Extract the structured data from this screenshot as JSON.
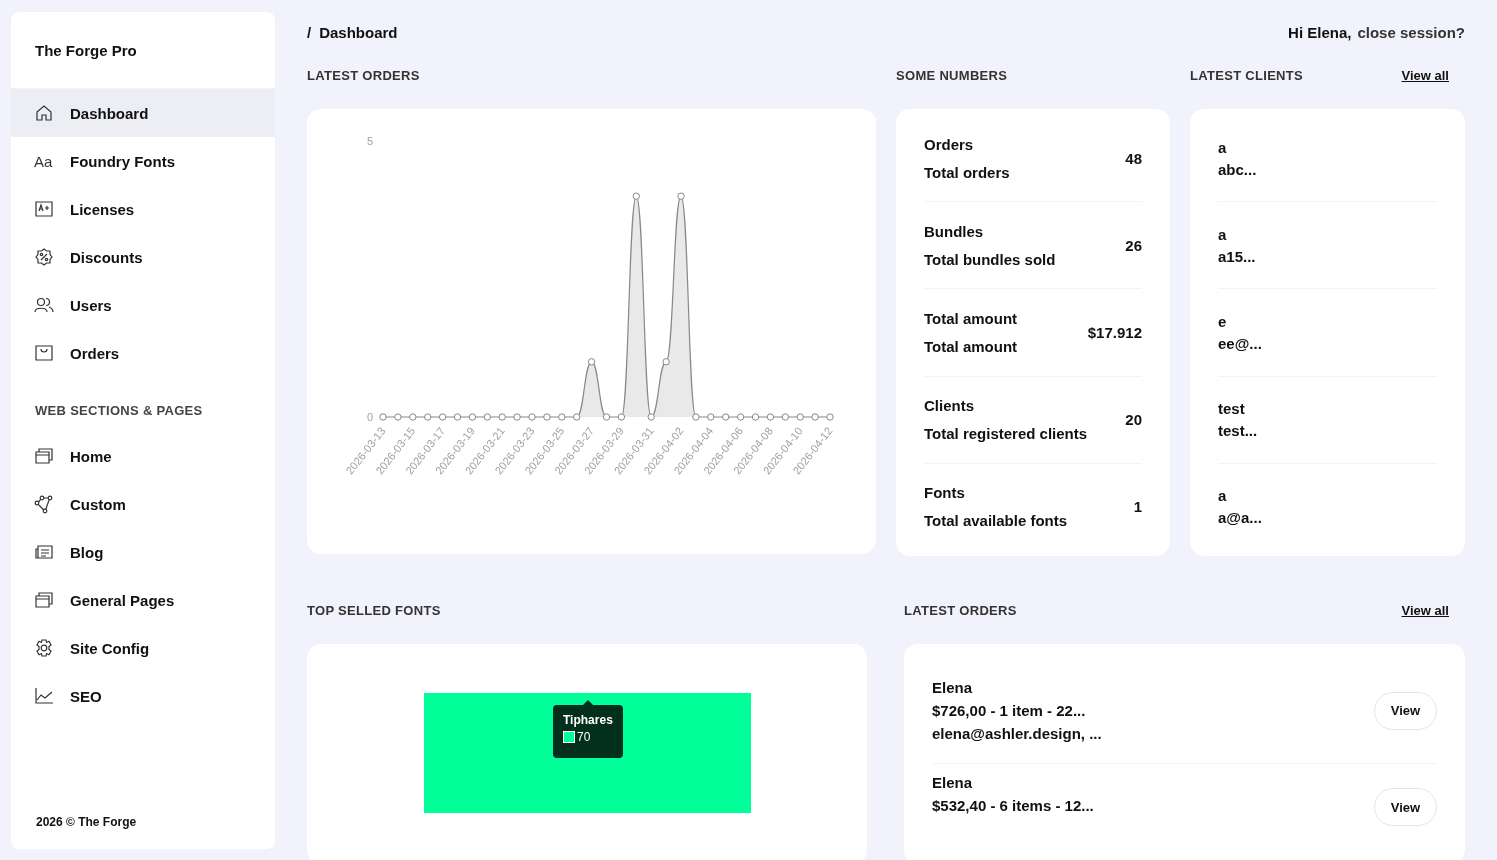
{
  "brand": "The Forge Pro",
  "sidebar": {
    "items": [
      {
        "label": "Dashboard",
        "selected": true
      },
      {
        "label": "Foundry Fonts",
        "glyph": "Aa",
        "selected": false
      },
      {
        "label": "Licenses",
        "selected": false
      },
      {
        "label": "Discounts",
        "selected": false
      },
      {
        "label": "Users",
        "selected": false
      },
      {
        "label": "Orders",
        "selected": false
      }
    ],
    "section_title": "WEB SECTIONS & PAGES",
    "section_items": [
      {
        "label": "Home",
        "selected": false
      },
      {
        "label": "Custom",
        "selected": false
      },
      {
        "label": "Blog",
        "selected": false
      },
      {
        "label": "General Pages",
        "selected": false
      },
      {
        "label": "Site Config",
        "selected": false
      },
      {
        "label": "SEO",
        "selected": false
      }
    ],
    "footer": "2026 © The Forge"
  },
  "breadcrumb": {
    "separator": "/",
    "current": "Dashboard"
  },
  "greeting": "Hi Elena,",
  "logout": "close session?",
  "latest_orders_chart": {
    "heading": "LATEST ORDERS",
    "chart_data": {
      "type": "area",
      "x": [
        "2026-03-13",
        "2026-03-14",
        "2026-03-15",
        "2026-03-16",
        "2026-03-17",
        "2026-03-18",
        "2026-03-19",
        "2026-03-20",
        "2026-03-21",
        "2026-03-22",
        "2026-03-23",
        "2026-03-24",
        "2026-03-25",
        "2026-03-26",
        "2026-03-27",
        "2026-03-28",
        "2026-03-29",
        "2026-03-30",
        "2026-03-31",
        "2026-04-01",
        "2026-04-02",
        "2026-04-03",
        "2026-04-04",
        "2026-04-05",
        "2026-04-06",
        "2026-04-07",
        "2026-04-08",
        "2026-04-09",
        "2026-04-10",
        "2026-04-11",
        "2026-04-12"
      ],
      "series": [
        {
          "color": "#888888",
          "values": [
            0,
            0,
            0,
            0,
            0,
            0,
            0,
            0,
            0,
            0,
            0,
            0,
            0,
            0,
            1,
            0,
            0,
            4,
            0,
            1,
            4,
            0,
            0,
            0,
            0,
            0,
            0,
            0,
            0,
            0,
            0
          ]
        }
      ],
      "xticks": [
        "2026-03-13",
        "2026-03-15",
        "2026-03-17",
        "2026-03-19",
        "2026-03-21",
        "2026-03-23",
        "2026-03-25",
        "2026-03-27",
        "2026-03-29",
        "2026-03-31",
        "2026-04-02",
        "2026-04-04",
        "2026-04-06",
        "2026-04-08",
        "2026-04-10",
        "2026-04-12"
      ],
      "xlim": [
        "2026-03-13",
        "2026-04-12"
      ],
      "ylim": [
        0,
        5
      ],
      "yticks": [
        0,
        5
      ]
    }
  },
  "some_numbers": {
    "heading": "SOME NUMBERS",
    "rows": [
      {
        "title": "Orders",
        "subtitle": "Total orders",
        "value": "48"
      },
      {
        "title": "Bundles",
        "subtitle": "Total bundles sold",
        "value": "26"
      },
      {
        "title": "Total amount",
        "subtitle": "Total amount",
        "value": "$17.912"
      },
      {
        "title": "Clients",
        "subtitle": "Total registered clients",
        "value": "20"
      },
      {
        "title": "Fonts",
        "subtitle": "Total available fonts",
        "value": "1"
      }
    ]
  },
  "latest_clients": {
    "heading": "LATEST CLIENTS",
    "link": "View all",
    "rows": [
      {
        "name": "a",
        "email": "abc..."
      },
      {
        "name": "a",
        "email": "a15..."
      },
      {
        "name": "e",
        "email": "ee@..."
      },
      {
        "name": "test",
        "email": "test..."
      },
      {
        "name": "a",
        "email": "a@a..."
      }
    ]
  },
  "top_selled_fonts": {
    "heading": "TOP SELLED FONTS",
    "tooltip": {
      "title": "Tiphares",
      "value": "70"
    }
  },
  "latest_orders": {
    "heading": "LATEST ORDERS",
    "link": "View all",
    "rows": [
      {
        "name": "Elena",
        "summary": "$726,00 - 1 item - 22...",
        "email": "elena@ashler.design, ...",
        "button": "View"
      },
      {
        "name": "Elena",
        "summary": "$532,40 - 6 items - 12...",
        "button": "View"
      }
    ]
  }
}
